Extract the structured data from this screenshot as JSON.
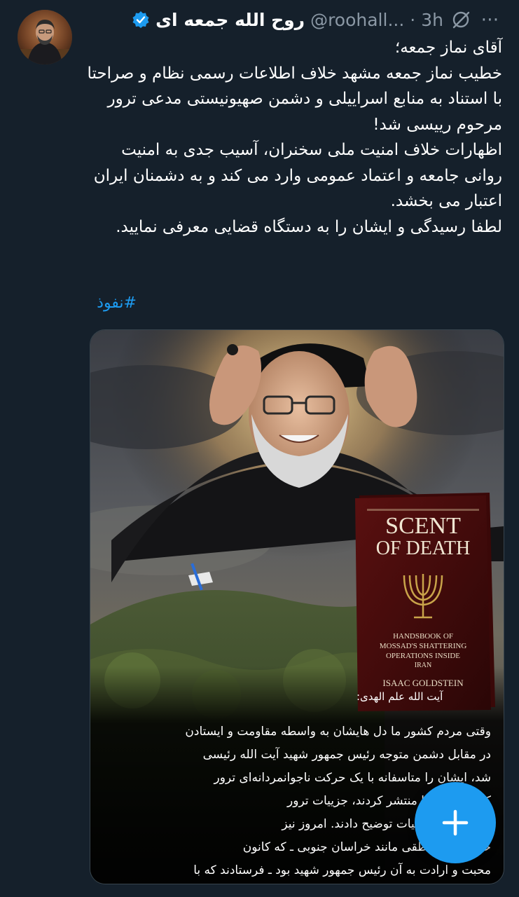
{
  "tweet": {
    "author_name": "روح الله جمعه ای",
    "handle": "@roohall...",
    "separator": "·",
    "time": "3h",
    "more": "⋯",
    "lines": [
      "آقای نماز جمعه؛",
      "خطیب نماز جمعه مشهد خلاف اطلاعات رسمی نظام و صراحتا با استناد به منابع اسراییلی و دشمن صهیونیستی مدعی ترور مرحوم رییسی شد!",
      "اظهارات خلاف امنیت ملی سخنران، آسیب جدی به امنیت روانی جامعه و اعتماد عمومی وارد می کند و به دشمنان ایران اعتبار می بخشد.",
      "لطفا رسیدگی و ایشان را به دستگاه قضایی معرفی نمایید."
    ],
    "hashtag": "#نفوذ"
  },
  "media": {
    "book": {
      "title_line1": "SCENT",
      "title_line2": "OF DEATH",
      "subtitle_line1": "HANDSBOOK OF",
      "subtitle_line2": "MOSSAD'S SHATTERING",
      "subtitle_line3": "OPERATIONS INSIDE",
      "subtitle_line4": "IRAN",
      "author": "ISAAC GOLDSTEIN"
    },
    "quote_heading": "آیت الله علم الهدی:",
    "quote_lines": [
      "وقتی مردم کشور ما دل هایشان به واسطه مقاومت و ایستادن",
      "در مقابل دشمن متوجه رئیس جمهور شهید آیت الله رئیسی",
      "شد، ایشان را متاسفانه با یک حرکت ناجوانمردانه‌ای ترور",
      "کتابی که اخیرا منتشر کردند، جزییات ترور",
      "خدمت را با جزییات توضیح دادند. امروز نیز",
      "خود را در مناطقی مانند خراسان جنوبی ـ که کانون",
      "محبت و ارادت به آن رئیس جمهور شهید بود ـ فرستادند که با"
    ]
  },
  "fab": {
    "label": "+"
  },
  "colors": {
    "background": "#15202b",
    "accent": "#1d9bf0",
    "secondary_text": "#8b98a5"
  }
}
